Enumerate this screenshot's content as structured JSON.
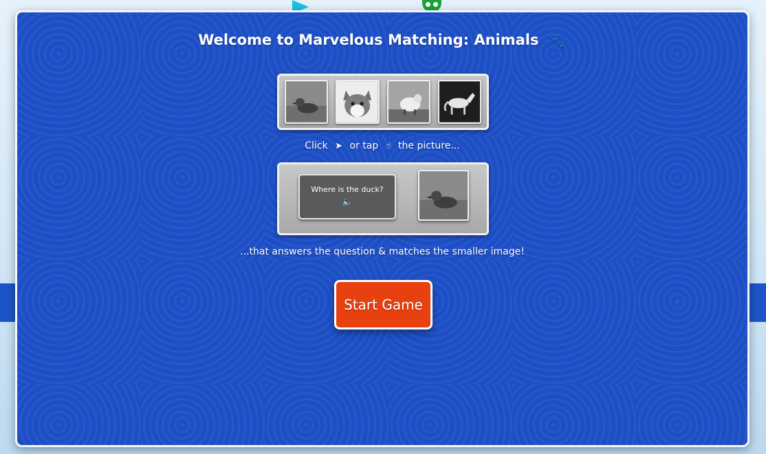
{
  "background": {
    "decorations": [
      "triangle-shape",
      "green-critter"
    ]
  },
  "modal": {
    "title": "Welcome to Marvelous Matching: Animals",
    "title_icon": "paw-icon",
    "preview_images": [
      {
        "animal": "duck"
      },
      {
        "animal": "cat"
      },
      {
        "animal": "sheep"
      },
      {
        "animal": "horse"
      }
    ],
    "instruction_top": {
      "click": "Click",
      "or_tap": "or tap",
      "the_picture": "the picture..."
    },
    "example": {
      "question": "Where is the duck?",
      "speaker_icon": "speaker-icon",
      "image": "duck"
    },
    "instruction_bottom": "...that answers the question & matches the smaller image!",
    "start_button": "Start Game"
  },
  "colors": {
    "modal_bg": "#1c4ec5",
    "button": "#e8400f"
  }
}
